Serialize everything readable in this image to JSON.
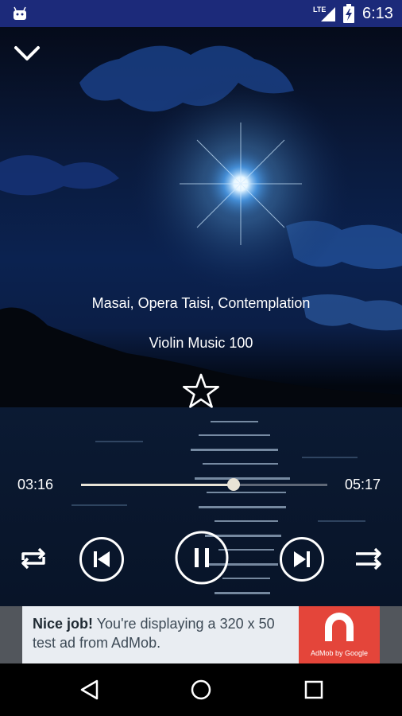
{
  "status_bar": {
    "network": "LTE",
    "time": "6:13"
  },
  "player": {
    "song_title": "Masai, Opera Taisi, Contemplation",
    "album": "Violin Music 100",
    "elapsed": "03:16",
    "duration": "05:17",
    "progress": 0.62,
    "favorite": false,
    "is_playing": true
  },
  "controls": {
    "collapse_icon": "chevron-down-icon",
    "favorite_icon": "star-outline-icon",
    "repeat_icon": "repeat-icon",
    "previous_icon": "skip-previous-icon",
    "play_pause_icon": "pause-icon",
    "next_icon": "skip-next-icon",
    "shuffle_icon": "shuffle-icon"
  },
  "ad": {
    "bold": "Nice job!",
    "text": " You're displaying a 320 x 50 test ad from AdMob.",
    "logo_caption": "AdMob by Google",
    "logo_color": "#e4453a"
  },
  "navigation": {
    "back_icon": "back-triangle-icon",
    "home_icon": "home-circle-icon",
    "recents_icon": "recents-square-icon"
  },
  "colors": {
    "status_bar": "#1c2a7a",
    "accent": "#e8e3d6"
  }
}
